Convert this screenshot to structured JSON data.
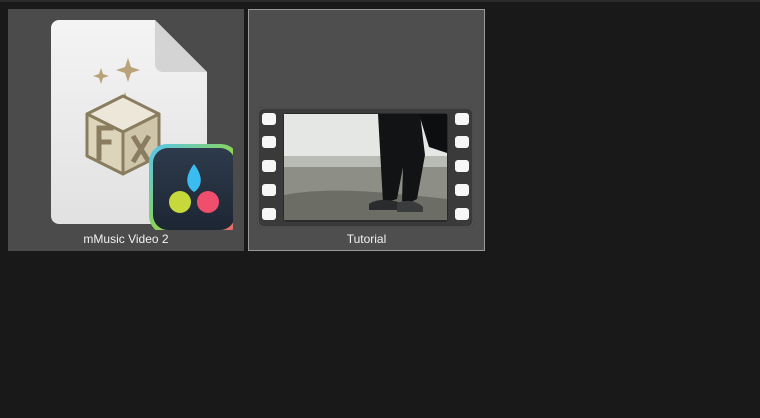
{
  "files": [
    {
      "name": "mMusic Video 2",
      "icon": "resolve-fx-project-file-icon",
      "selected": false
    },
    {
      "name": "Tutorial",
      "icon": "video-file-thumbnail",
      "selected": true
    }
  ],
  "colors": {
    "background": "#191919",
    "tile": "#4b4b4b",
    "selected_border": "#9a9a9a",
    "label": "#f2f2f2"
  }
}
